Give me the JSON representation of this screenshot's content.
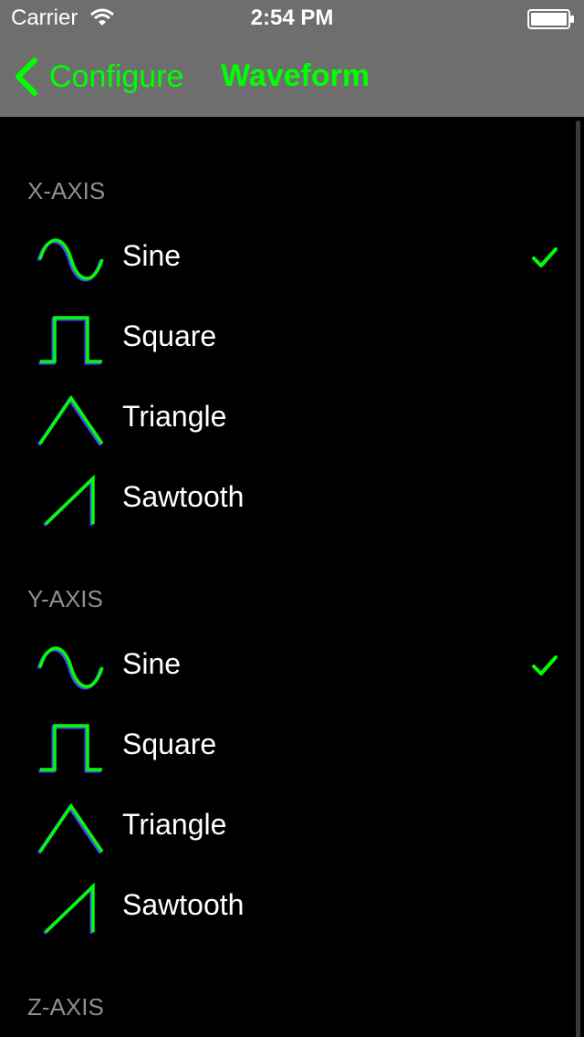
{
  "status_bar": {
    "carrier": "Carrier",
    "time": "2:54 PM",
    "icons": [
      "wifi-icon",
      "battery-icon"
    ]
  },
  "nav": {
    "back_label": "Configure",
    "title": "Waveform",
    "tint": "#00ff00",
    "background": "#6e6e6e"
  },
  "sections": [
    {
      "header": "X-AXIS",
      "items": [
        {
          "label": "Sine",
          "icon": "sine-wave-icon",
          "selected": true
        },
        {
          "label": "Square",
          "icon": "square-wave-icon",
          "selected": false
        },
        {
          "label": "Triangle",
          "icon": "triangle-wave-icon",
          "selected": false
        },
        {
          "label": "Sawtooth",
          "icon": "sawtooth-wave-icon",
          "selected": false
        }
      ]
    },
    {
      "header": "Y-AXIS",
      "items": [
        {
          "label": "Sine",
          "icon": "sine-wave-icon",
          "selected": true
        },
        {
          "label": "Square",
          "icon": "square-wave-icon",
          "selected": false
        },
        {
          "label": "Triangle",
          "icon": "triangle-wave-icon",
          "selected": false
        },
        {
          "label": "Sawtooth",
          "icon": "sawtooth-wave-icon",
          "selected": false
        }
      ]
    },
    {
      "header": "Z-AXIS",
      "items": []
    }
  ],
  "colors": {
    "accent": "#00ff00",
    "icon_shadow": "#4a4aff",
    "section_header": "#8e8e93"
  }
}
